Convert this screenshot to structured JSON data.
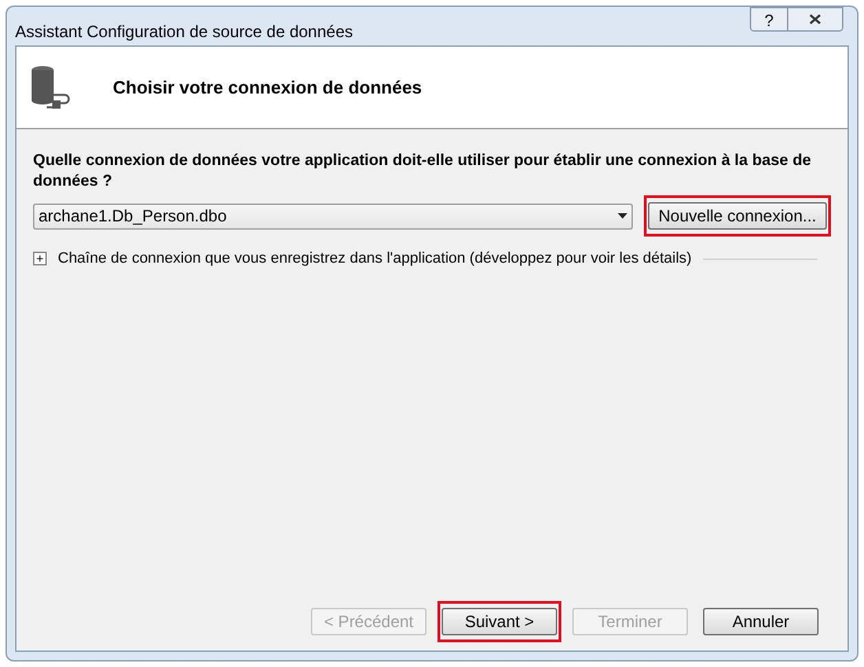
{
  "window": {
    "title": "Assistant Configuration de source de données",
    "help": "?"
  },
  "header": {
    "title": "Choisir votre connexion de données"
  },
  "question": "Quelle connexion de données votre application doit-elle utiliser pour établir une connexion à la base de données ?",
  "connection_select": {
    "value": "archane1.Db_Person.dbo"
  },
  "new_connection_button": {
    "label": "Nouvelle connexion...",
    "highlighted": true
  },
  "connection_string": {
    "expand": "+",
    "label": "Chaîne de connexion que vous enregistrez dans l'application (développez pour voir les détails)",
    "expanded": false
  },
  "buttons": [
    {
      "label": "< Précédent",
      "disabled": true,
      "highlighted": false
    },
    {
      "label": "Suivant >",
      "disabled": false,
      "highlighted": true
    },
    {
      "label": "Terminer",
      "disabled": true,
      "highlighted": false
    },
    {
      "label": "Annuler",
      "disabled": false,
      "highlighted": false
    }
  ]
}
